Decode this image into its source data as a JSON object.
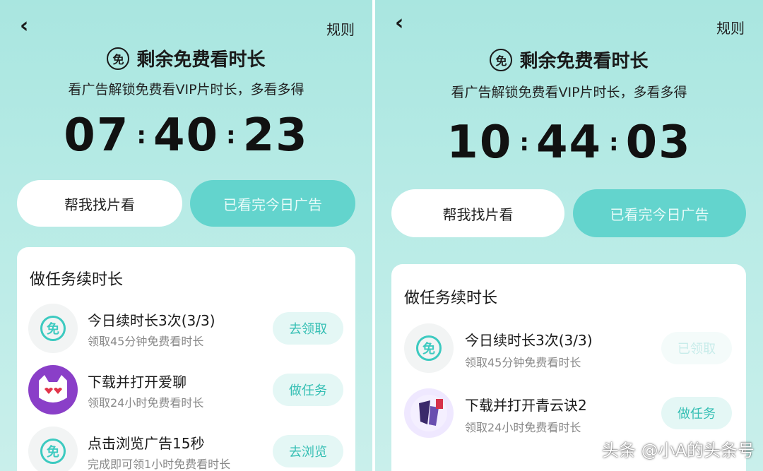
{
  "left": {
    "rules": "规则",
    "title": "剩余免费看时长",
    "badge_char": "免",
    "subtitle": "看广告解锁免费看VIP片时长，多看多得",
    "timer": {
      "hours": "07",
      "minutes": "40",
      "seconds": "23"
    },
    "find_button": "帮我找片看",
    "ads_done_button": "已看完今日广告",
    "tasks_title": "做任务续时长",
    "tasks": [
      {
        "icon": "free-icon",
        "icon_char": "免",
        "name": "今日续时长3次(3/3)",
        "desc": "领取45分钟免费看时长",
        "action": "去领取"
      },
      {
        "icon": "cat-app-icon",
        "name": "下载并打开爱聊",
        "desc": "领取24小时免费看时长",
        "action": "做任务"
      },
      {
        "icon": "free-icon",
        "icon_char": "免",
        "name": "点击浏览广告15秒",
        "desc": "完成即可领1小时免费看时长",
        "action": "去浏览"
      }
    ]
  },
  "right": {
    "rules": "规则",
    "title": "剩余免费看时长",
    "badge_char": "免",
    "subtitle": "看广告解锁免费看VIP片时长，多看多得",
    "timer": {
      "hours": "10",
      "minutes": "44",
      "seconds": "03"
    },
    "find_button": "帮我找片看",
    "ads_done_button": "已看完今日广告",
    "tasks_title": "做任务续时长",
    "tasks": [
      {
        "icon": "free-icon",
        "icon_char": "免",
        "name": "今日续时长3次(3/3)",
        "desc": "领取45分钟免费看时长",
        "action": "已领取"
      },
      {
        "icon": "game-app-icon",
        "name": "下载并打开青云诀2",
        "desc": "领取24小时免费看时长",
        "action": "做任务"
      }
    ]
  },
  "watermark": "头条 @小A的头条号",
  "colors": {
    "accent": "#3ccac0",
    "teal_button": "#63d4cd",
    "background": "#b8ebe6"
  }
}
